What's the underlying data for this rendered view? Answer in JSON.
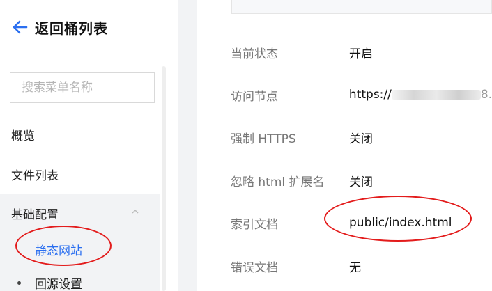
{
  "sidebar": {
    "back_label": "返回桶列表",
    "search_placeholder": "搜索菜单名称",
    "items": [
      {
        "label": "概览"
      },
      {
        "label": "文件列表"
      },
      {
        "label": "基础配置"
      }
    ],
    "sub_items": [
      {
        "label": "静态网站",
        "active": true
      },
      {
        "label": "回源设置",
        "active": false
      }
    ]
  },
  "details": [
    {
      "key": "当前状态",
      "value": "开启"
    },
    {
      "key": "访问节点",
      "value_prefix": "https://",
      "value_suffix": "8."
    },
    {
      "key": "强制 HTTPS",
      "value": "关闭"
    },
    {
      "key": "忽略 html 扩展名",
      "value": "关闭"
    },
    {
      "key": "索引文档",
      "value": "public/index.html"
    },
    {
      "key": "错误文档",
      "value": "无"
    }
  ],
  "colors": {
    "accent": "#2b6ff0",
    "annotation": "#e31c1c"
  }
}
